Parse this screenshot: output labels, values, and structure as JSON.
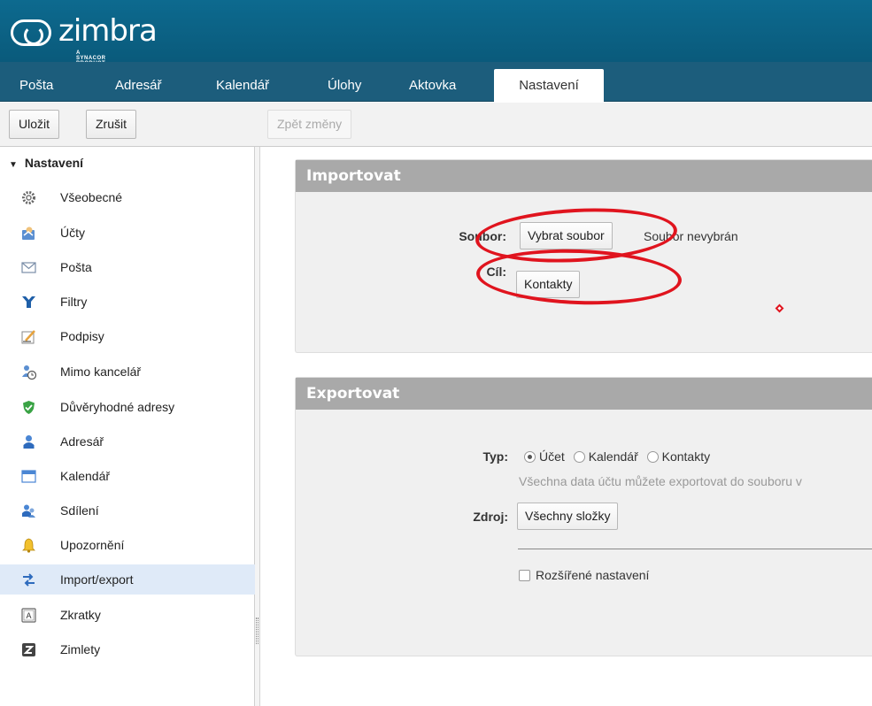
{
  "app": {
    "logo_text": "zimbra",
    "logo_subtitle": "A SYNACOR PRODUCT"
  },
  "nav": {
    "tabs": [
      {
        "label": "Pošta"
      },
      {
        "label": "Adresář"
      },
      {
        "label": "Kalendář"
      },
      {
        "label": "Úlohy"
      },
      {
        "label": "Aktovka"
      },
      {
        "label": "Nastavení",
        "active": true
      }
    ]
  },
  "toolbar": {
    "save_label": "Uložit",
    "cancel_label": "Zrušit",
    "revert_label": "Zpět změny"
  },
  "sidebar": {
    "header": "Nastavení",
    "items": [
      {
        "label": "Všeobecné",
        "icon": "gears-icon"
      },
      {
        "label": "Účty",
        "icon": "accounts-icon"
      },
      {
        "label": "Pošta",
        "icon": "envelope-icon"
      },
      {
        "label": "Filtry",
        "icon": "filter-icon"
      },
      {
        "label": "Podpisy",
        "icon": "signature-icon"
      },
      {
        "label": "Mimo kancelář",
        "icon": "out-of-office-icon"
      },
      {
        "label": "Důvěryhodné adresy",
        "icon": "shield-icon"
      },
      {
        "label": "Adresář",
        "icon": "person-icon"
      },
      {
        "label": "Kalendář",
        "icon": "calendar-icon"
      },
      {
        "label": "Sdílení",
        "icon": "sharing-icon"
      },
      {
        "label": "Upozornění",
        "icon": "bell-icon"
      },
      {
        "label": "Import/export",
        "icon": "import-export-icon",
        "selected": true
      },
      {
        "label": "Zkratky",
        "icon": "shortcut-key-icon"
      },
      {
        "label": "Zimlety",
        "icon": "zimlet-icon"
      }
    ]
  },
  "import_panel": {
    "title": "Importovat",
    "file_label": "Soubor:",
    "choose_file_button": "Vybrat soubor",
    "no_file_text": "Soubor nevybrán",
    "target_label": "Cíl:",
    "target_button": "Kontakty"
  },
  "export_panel": {
    "title": "Exportovat",
    "type_label": "Typ:",
    "type_options": [
      "Účet",
      "Kalendář",
      "Kontakty"
    ],
    "type_selected": "Účet",
    "hint": "Všechna data účtu můžete exportovat do souboru v",
    "source_label": "Zdroj:",
    "source_button": "Všechny složky",
    "advanced_label": "Rozšířené nastavení",
    "advanced_checked": false
  },
  "colors": {
    "header": "#0d6a8f",
    "nav": "#1c5d7c",
    "panel_title": "#a9a9a9",
    "annotation": "#e0141e",
    "selected_row": "#dfeaf8"
  }
}
